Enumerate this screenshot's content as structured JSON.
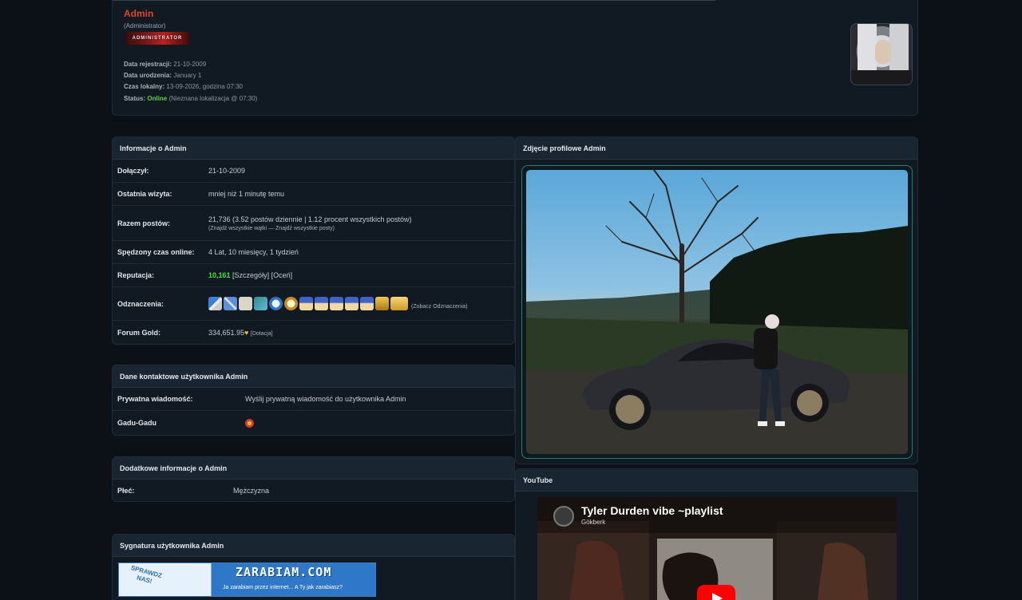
{
  "profile": {
    "username": "Admin",
    "usertitle": "(Administrator)",
    "rank_badge": "ADMINISTRATOR",
    "registration_label": "Data rejestracji:",
    "registration_value": "21-10-2009",
    "birthday_label": "Data urodzenia:",
    "birthday_value": "January 1",
    "localtime_label": "Czas lokalny:",
    "localtime_value": "13-09-2026, godzina 07:30",
    "status_label": "Status:",
    "status_value": "Online",
    "status_location": "(Nieznana lokalizacja @ 07:30)"
  },
  "info_panel": {
    "title": "Informacje o Admin",
    "joined_label": "Dołączył:",
    "joined_value": "21-10-2009",
    "last_visit_label": "Ostatnia wizyta:",
    "last_visit_value": "mniej niż 1 minutę temu",
    "posts_label": "Razem postów:",
    "posts_value": "21,736 (3.52 postów dziennie | 1.12 procent wszystkich postów)",
    "posts_open": "(",
    "posts_find_threads": "Znajdź wszystkie wątki",
    "posts_sep": " — ",
    "posts_find_posts": "Znajdź wszystkie posty",
    "posts_close": ")",
    "online_time_label": "Spędzony czas online:",
    "online_time_value": "4 Lat, 10 miesięcy, 1 tydzień",
    "reputation_label": "Reputacja:",
    "reputation_value": "10,161",
    "reputation_details": "[Szczegóły]",
    "reputation_rate": "[Oceń]",
    "awards_label": "Odznaczenia:",
    "awards_link": "(Zobacz Odznaczenia)",
    "forum_gold_label": "Forum Gold:",
    "forum_gold_value": "334,651.95",
    "forum_gold_donate": "[Dotacja]"
  },
  "contact_panel": {
    "title": "Dane kontaktowe użytkownika Admin",
    "pm_label": "Prywatna wiadomość:",
    "pm_link": "Wyślij prywatną wiadomość do użytkownika Admin",
    "gg_label": "Gadu-Gadu"
  },
  "extra_panel": {
    "title": "Dodatkowe informacje o Admin",
    "gender_label": "Płeć:",
    "gender_value": "Mężczyzna"
  },
  "signature_panel": {
    "title": "Sygnatura użytkownika Admin",
    "banner_left": "SPRAWDZ NAS!",
    "banner_brand": "ZARABIAM.COM",
    "banner_sub": "Ja zarabiam przez internet... A Ty jak zarabiasz?"
  },
  "photo_panel": {
    "title": "Zdjęcie profilowe Admin"
  },
  "youtube_panel": {
    "title": "YouTube",
    "video_title": "Tyler Durden vibe ~playlist",
    "channel": "Gökberk"
  },
  "colors": {
    "background": "#0b1117",
    "panel": "#111923",
    "panel_head": "#1a2532",
    "username": "#e2462b",
    "online": "#5ad13a",
    "reputation": "#3de62f"
  }
}
